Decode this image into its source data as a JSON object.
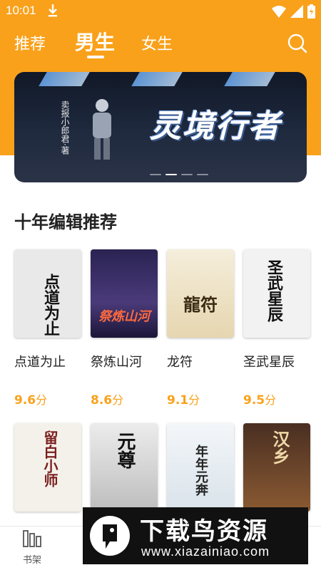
{
  "status_bar": {
    "time": "10:01"
  },
  "header": {
    "tabs": [
      {
        "label": "推荐",
        "active": false
      },
      {
        "label": "男生",
        "active": true
      },
      {
        "label": "女生",
        "active": false
      }
    ],
    "background_color": "#f9a11b"
  },
  "banner": {
    "title": "灵境行者",
    "author_line": "卖报小郎君·著",
    "page_count": 4,
    "active_page": 1
  },
  "section": {
    "title": "十年编辑推荐",
    "books": [
      {
        "name": "点道为止",
        "score": "9.6",
        "unit": "分",
        "cover_text": "点道为止",
        "cover_color": "#e9e9e9"
      },
      {
        "name": "祭炼山河",
        "score": "8.6",
        "unit": "分",
        "cover_text": "祭炼山河",
        "cover_color": "#3a2d63"
      },
      {
        "name": "龙符",
        "score": "9.1",
        "unit": "分",
        "cover_text": "龍符",
        "cover_color": "#efe6cf"
      },
      {
        "name": "圣武星辰",
        "score": "9.5",
        "unit": "分",
        "cover_text": "圣武星辰",
        "cover_color": "#f2f2f2"
      }
    ],
    "books_row2": [
      {
        "cover_text": "留白小师",
        "cover_color": "#f4f1ea"
      },
      {
        "cover_text": "元尊",
        "cover_color": "#d9d9d9"
      },
      {
        "cover_text": "年年元奔",
        "cover_color": "#e8eef3"
      },
      {
        "cover_text": "汉乡",
        "cover_color": "#5a3c2a"
      }
    ]
  },
  "tab_bar": {
    "items": [
      {
        "label": "书架"
      }
    ]
  },
  "watermark": {
    "title": "下载鸟资源",
    "url": "www.xiazainiao.com"
  }
}
